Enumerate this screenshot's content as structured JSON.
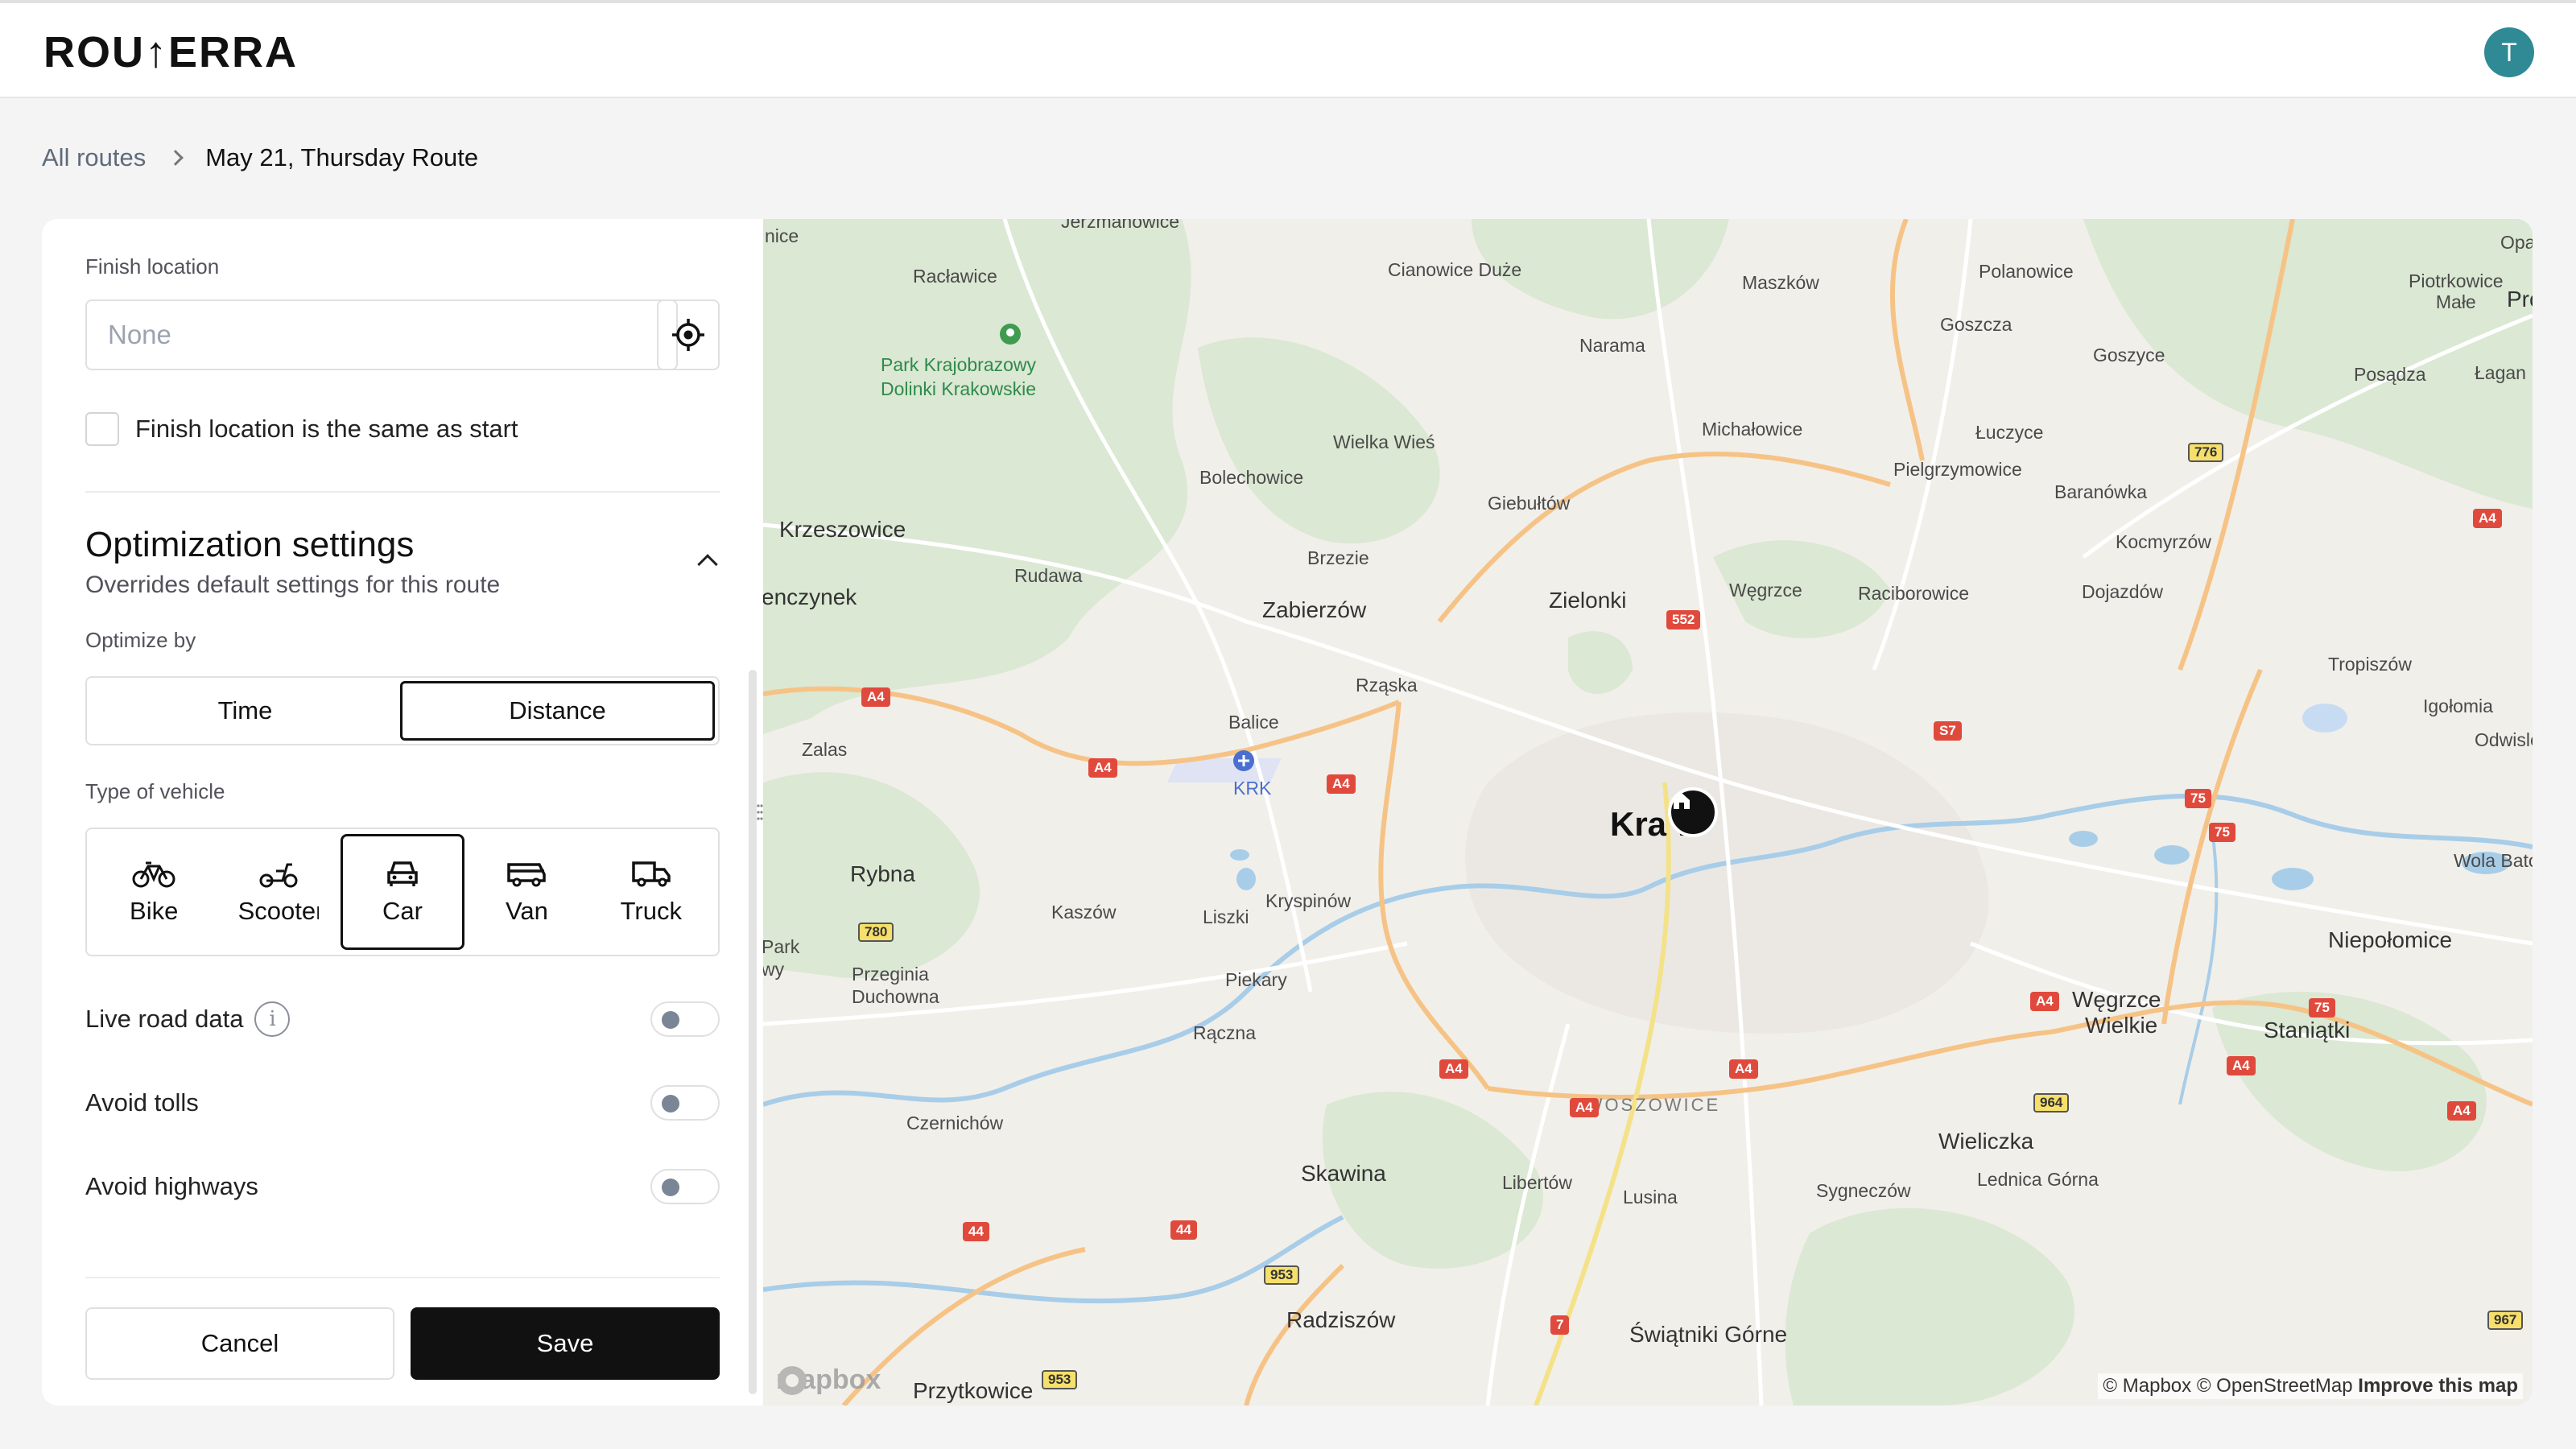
{
  "app": {
    "logo": "ROU↑ERRA",
    "avatar_initial": "T"
  },
  "breadcrumb": {
    "root": "All routes",
    "current": "May 21, Thursday Route"
  },
  "panel": {
    "finish_label": "Finish location",
    "finish_placeholder": "None",
    "same_as_start": "Finish location is the same as start",
    "opt_title": "Optimization settings",
    "opt_subtitle": "Overrides default settings for this route",
    "optimize_by_label": "Optimize by",
    "optimize_options": [
      "Time",
      "Distance"
    ],
    "optimize_selected": "Distance",
    "vehicle_label": "Type of vehicle",
    "vehicles": [
      "Bike",
      "Scooter",
      "Car",
      "Van",
      "Truck"
    ],
    "vehicle_selected": "Car",
    "toggles": [
      {
        "label": "Live road data",
        "on": false
      },
      {
        "label": "Avoid tolls",
        "on": false
      },
      {
        "label": "Avoid highways",
        "on": false
      }
    ],
    "cancel": "Cancel",
    "save": "Save"
  },
  "map": {
    "city": "Kraków",
    "city_shown": "Kra w",
    "places": [
      "Racławice",
      "Park Krajobrazowy",
      "Dolinki Krakowskie",
      "Cianowice Duże",
      "Maszków",
      "Polanowice",
      "Opatkowice",
      "Pro",
      "Piotrkowice",
      "Małe",
      "Narama",
      "Goszcza",
      "Goszyce",
      "Posądza",
      "Łagan",
      "Wielka Wieś",
      "Michałowice",
      "Łuczyce",
      "Bolechowice",
      "Pielgrzymowice",
      "Baranówka",
      "Giebułtów",
      "Krzeszowice",
      "Kocmyrzów",
      "Brzezie",
      "Rudawa",
      "Zielonki",
      "Węgrzce",
      "Raciborowice",
      "Dojazdów",
      "enczynek",
      "Zabierzów",
      "Tropiszów",
      "Rząska",
      "Igołomia",
      "Balice",
      "Odwisle",
      "Zalas",
      "KRK",
      "Rybna",
      "Kryspinów",
      "Kaszów",
      "Liszki",
      "Wola Batorska",
      "Przeginia",
      "Duchowna",
      "Niepołomice",
      "Piekary",
      "Węgrzce",
      "Wielkie",
      "Staniątki",
      "Rączna",
      "SWOSZOWICE",
      "Czernichów",
      "Wieliczka",
      "Skawina",
      "Libertów",
      "Lusina",
      "Sygneczów",
      "Lednica Górna",
      "Radziszów",
      "Świątniki Górne",
      "Przytkowice",
      "Jerzmanowice",
      "nice",
      "Park",
      "wy"
    ],
    "roads": [
      "A4",
      "A4",
      "A4",
      "A4",
      "A4",
      "A4",
      "A4",
      "A4",
      "A4",
      "A4",
      "552",
      "S7",
      "75",
      "75",
      "75",
      "776",
      "780",
      "964",
      "953",
      "953",
      "967",
      "44",
      "44",
      "7"
    ],
    "attribution": "© Mapbox © OpenStreetMap",
    "improve": "Improve this map",
    "mapbox": "mapbox"
  }
}
